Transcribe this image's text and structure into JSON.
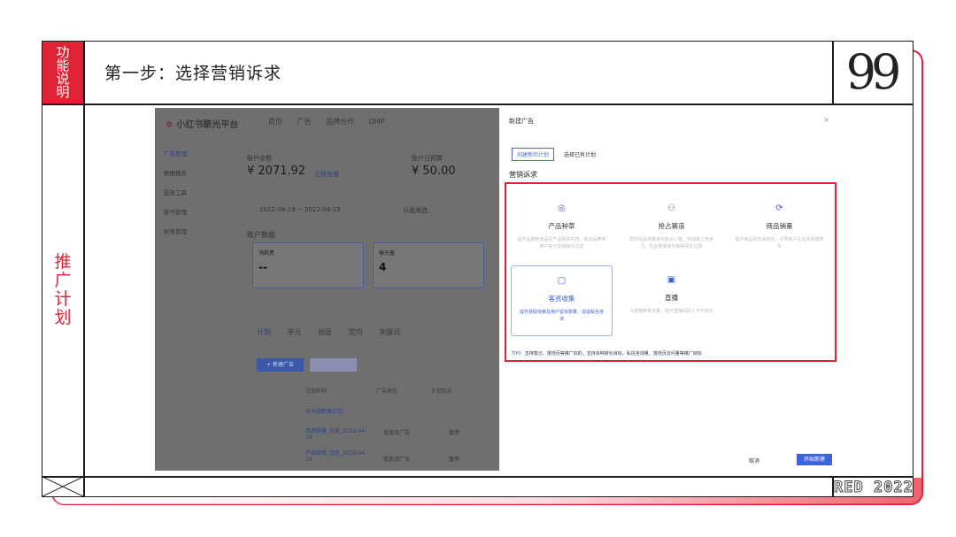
{
  "header": {
    "section_tag": "功能说明",
    "title": "第一步：选择营销诉求",
    "quote_glyph": "99"
  },
  "side": {
    "label": "推广计划"
  },
  "footer": {
    "brand_year": "RED 2022"
  },
  "app": {
    "logo": "小红书聚光平台",
    "nav": [
      "首页",
      "广告",
      "品牌合作",
      "DMP"
    ],
    "sidebar": [
      "广告管理",
      "数据报告",
      "投放工具",
      "账号管理",
      "财务管理"
    ],
    "account_balance_label": "账户余额",
    "account_balance": "¥ 2071.92",
    "daily_budget_label": "账户日预算",
    "daily_budget": "¥ 50.00",
    "recharge": "立即充值",
    "date_range": "2022-04-19  ~  2022-04-19",
    "filter": "分组筛选",
    "overview": "账户数据",
    "card1_label": "消耗费",
    "card1_value": "--",
    "card2_label": "曝光量",
    "card2_value": "4",
    "tabs": [
      "计划",
      "单元",
      "创意",
      "定向",
      "关键词"
    ],
    "new_ad_button": "+ 新建广告",
    "columns": [
      "计划名称",
      "广告类型",
      "计划状态"
    ],
    "rows": [
      {
        "name": "未分组新建计划",
        "type": "",
        "status": ""
      },
      {
        "name": "商品销量_信息_2022-04-19",
        "type": "信息流广告",
        "status": "暂停"
      },
      {
        "name": "产品种草_信息_2022-04-19",
        "type": "信息流广告",
        "status": "暂停"
      }
    ]
  },
  "modal": {
    "title": "新建广告",
    "close": "×",
    "tab_new": "创建新的计划",
    "tab_existing": "选择已有计划",
    "section": "营销诉求",
    "options": [
      {
        "name": "产品种草",
        "desc": "提升品牌和商品在产品相关内容，促进品牌和用户的沉淀和转化沉淀",
        "icon": "◎"
      },
      {
        "name": "抢占赛道",
        "desc": "帮你在品类赛道中抢占心智，快速建立竞争力，在品类赛道中获得领先位置",
        "icon": "⚇"
      },
      {
        "name": "商品销量",
        "desc": "提升商品的交易转化，引导用户在站内完成购买",
        "icon": "⟳"
      },
      {
        "name": "客资收集",
        "desc": "提升获取线索及用户留资数量，促成私信咨询",
        "icon": "▢"
      },
      {
        "name": "直播",
        "desc": "为直播带来流量，提升直播间的人气与转化",
        "icon": "▣"
      }
    ],
    "tips_label": "TIPS",
    "tips_text": "支持笔记、落地页等推广标的，支持多种转化目标，私信咨询量、落地页访问量等推广目标",
    "cancel": "取消",
    "start": "开始新建"
  }
}
